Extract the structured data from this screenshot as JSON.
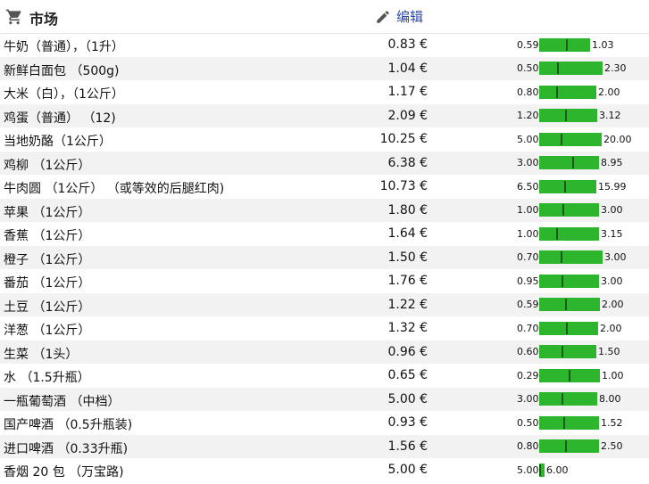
{
  "header": {
    "title": "市场",
    "edit_label": "编辑",
    "cart_icon": "shopping-cart-icon",
    "edit_icon": "pencil-icon"
  },
  "bar_color": "#2db52d",
  "rows": [
    {
      "name": "牛奶（普通），（1升）",
      "price": "0.83 €",
      "min": 0.59,
      "max": 1.03,
      "min_label": "0.59",
      "max_label": "1.03"
    },
    {
      "name": "新鲜白面包 （500g)",
      "price": "1.04 €",
      "min": 0.5,
      "max": 2.3,
      "min_label": "0.50",
      "max_label": "2.30"
    },
    {
      "name": "大米（白），（1公斤）",
      "price": "1.17 €",
      "min": 0.8,
      "max": 2.0,
      "min_label": "0.80",
      "max_label": "2.00"
    },
    {
      "name": "鸡蛋（普通） （12)",
      "price": "2.09 €",
      "min": 1.2,
      "max": 3.12,
      "min_label": "1.20",
      "max_label": "3.12"
    },
    {
      "name": "当地奶酪（1公斤）",
      "price": "10.25 €",
      "min": 5.0,
      "max": 20.0,
      "min_label": "5.00",
      "max_label": "20.00"
    },
    {
      "name": "鸡柳 （1公斤）",
      "price": "6.38 €",
      "min": 3.0,
      "max": 8.95,
      "min_label": "3.00",
      "max_label": "8.95"
    },
    {
      "name": "牛肉圆 （1公斤） （或等效的后腿红肉)",
      "price": "10.73 €",
      "min": 6.5,
      "max": 15.99,
      "min_label": "6.50",
      "max_label": "15.99"
    },
    {
      "name": "苹果 （1公斤）",
      "price": "1.80 €",
      "min": 1.0,
      "max": 3.0,
      "min_label": "1.00",
      "max_label": "3.00"
    },
    {
      "name": "香蕉 （1公斤）",
      "price": "1.64 €",
      "min": 1.0,
      "max": 3.15,
      "min_label": "1.00",
      "max_label": "3.15"
    },
    {
      "name": "橙子 （1公斤）",
      "price": "1.50 €",
      "min": 0.7,
      "max": 3.0,
      "min_label": "0.70",
      "max_label": "3.00"
    },
    {
      "name": "番茄 （1公斤）",
      "price": "1.76 €",
      "min": 0.95,
      "max": 3.0,
      "min_label": "0.95",
      "max_label": "3.00"
    },
    {
      "name": "土豆 （1公斤）",
      "price": "1.22 €",
      "min": 0.59,
      "max": 2.0,
      "min_label": "0.59",
      "max_label": "2.00"
    },
    {
      "name": "洋葱 （1公斤）",
      "price": "1.32 €",
      "min": 0.7,
      "max": 2.0,
      "min_label": "0.70",
      "max_label": "2.00"
    },
    {
      "name": "生菜 （1头）",
      "price": "0.96 €",
      "min": 0.6,
      "max": 1.5,
      "min_label": "0.60",
      "max_label": "1.50"
    },
    {
      "name": "水 （1.5升瓶）",
      "price": "0.65 €",
      "min": 0.29,
      "max": 1.0,
      "min_label": "0.29",
      "max_label": "1.00"
    },
    {
      "name": "一瓶葡萄酒 （中档）",
      "price": "5.00 €",
      "min": 3.0,
      "max": 8.0,
      "min_label": "3.00",
      "max_label": "8.00"
    },
    {
      "name": "国产啤酒 （0.5升瓶装)",
      "price": "0.93 €",
      "min": 0.5,
      "max": 1.52,
      "min_label": "0.50",
      "max_label": "1.52"
    },
    {
      "name": "进口啤酒 （0.33升瓶)",
      "price": "1.56 €",
      "min": 0.8,
      "max": 2.5,
      "min_label": "0.80",
      "max_label": "2.50"
    },
    {
      "name": "香烟 20 包 （万宝路)",
      "price": "5.00 €",
      "min": 5.0,
      "max": 6.0,
      "min_label": "5.00",
      "max_label": "6.00"
    }
  ]
}
